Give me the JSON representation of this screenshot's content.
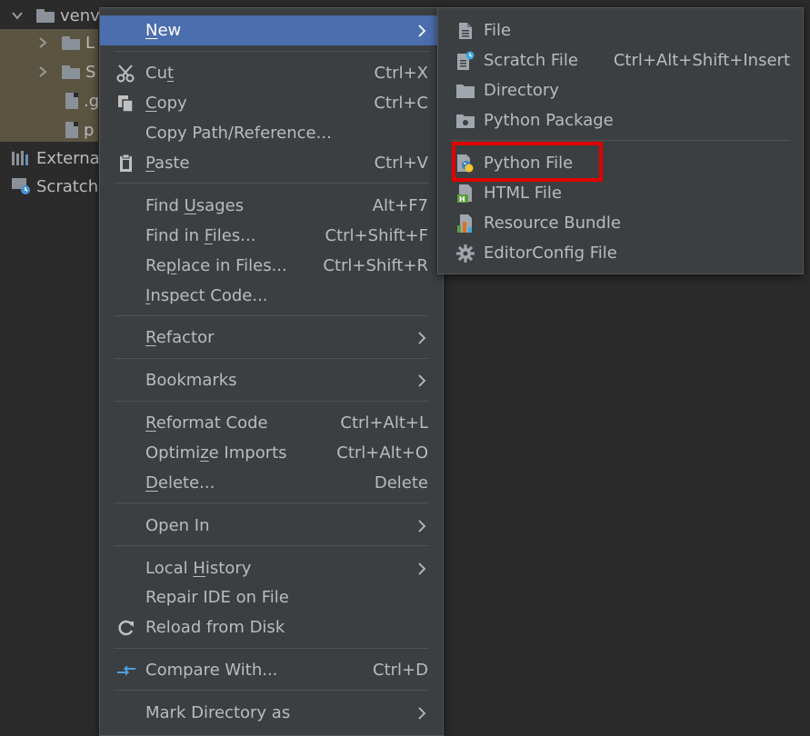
{
  "tree": {
    "rows": [
      {
        "label": "venv"
      },
      {
        "label": "L"
      },
      {
        "label": "S"
      },
      {
        "label": ".g"
      },
      {
        "label": "p"
      },
      {
        "label": "External"
      },
      {
        "label": "Scratche"
      }
    ]
  },
  "context_menu": {
    "new": {
      "label": "New",
      "u": "N",
      "rest": "ew"
    },
    "cut": {
      "u": "t",
      "pre": "Cu",
      "rest": "",
      "shortcut": "Ctrl+X"
    },
    "copy": {
      "u": "C",
      "pre": "",
      "rest": "opy",
      "shortcut": "Ctrl+C"
    },
    "copy_path": {
      "label": "Copy Path/Reference..."
    },
    "paste": {
      "u": "P",
      "pre": "",
      "rest": "aste",
      "shortcut": "Ctrl+V"
    },
    "find_usages": {
      "pre": "Find ",
      "u": "U",
      "rest": "sages",
      "shortcut": "Alt+F7"
    },
    "find_in_files": {
      "pre": "Find in ",
      "u": "F",
      "rest": "iles...",
      "shortcut": "Ctrl+Shift+F"
    },
    "replace_in_files": {
      "pre": "Re",
      "u": "p",
      "rest": "lace in Files...",
      "shortcut": "Ctrl+Shift+R"
    },
    "inspect_code": {
      "pre": "",
      "u": "I",
      "rest": "nspect Code..."
    },
    "refactor": {
      "pre": "",
      "u": "R",
      "rest": "efactor"
    },
    "bookmarks": {
      "label": "Bookmarks"
    },
    "reformat": {
      "pre": "",
      "u": "R",
      "rest": "eformat Code",
      "shortcut": "Ctrl+Alt+L"
    },
    "optimize": {
      "pre": "Optimi",
      "u": "z",
      "rest": "e Imports",
      "shortcut": "Ctrl+Alt+O"
    },
    "delete": {
      "pre": "",
      "u": "D",
      "rest": "elete...",
      "shortcut": "Delete"
    },
    "open_in": {
      "label": "Open In"
    },
    "local_history": {
      "pre": "Local ",
      "u": "H",
      "rest": "istory"
    },
    "repair_ide": {
      "label": "Repair IDE on File"
    },
    "reload": {
      "label": "Reload from Disk"
    },
    "compare": {
      "label": "Compare With...",
      "shortcut": "Ctrl+D"
    },
    "mark_dir": {
      "label": "Mark Directory as"
    }
  },
  "new_submenu": {
    "items": [
      {
        "label": "File",
        "icon": "file-icon"
      },
      {
        "label": "Scratch File",
        "icon": "scratch-file-icon",
        "shortcut": "Ctrl+Alt+Shift+Insert"
      },
      {
        "label": "Directory",
        "icon": "directory-icon"
      },
      {
        "label": "Python Package",
        "icon": "python-package-icon"
      },
      {
        "label": "Python File",
        "icon": "python-file-icon"
      },
      {
        "label": "HTML File",
        "icon": "html-file-icon"
      },
      {
        "label": "Resource Bundle",
        "icon": "resource-bundle-icon"
      },
      {
        "label": "EditorConfig File",
        "icon": "editorconfig-gear-icon"
      }
    ]
  },
  "colors": {
    "background": "#2b2b2b",
    "menu": "#3c3f41",
    "selected": "#4b6eaf",
    "highlight_box": "#e00000",
    "tree_highlight": "#5a5441"
  }
}
